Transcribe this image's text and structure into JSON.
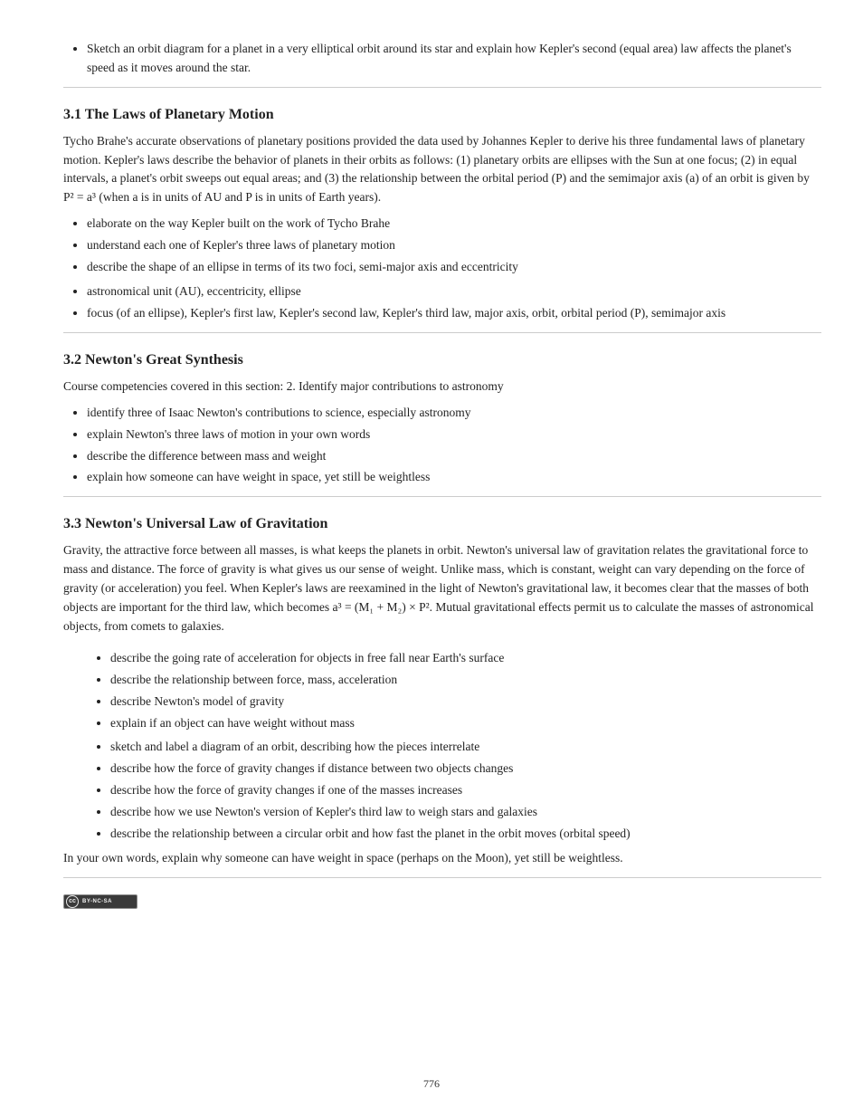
{
  "top_list": {
    "items": [
      "Sketch an orbit diagram for a planet in a very elliptical orbit around its star and explain how Kepler's second (equal area) law affects the planet's speed as it moves around the star."
    ]
  },
  "sec1": {
    "title": "3.1 The Laws of Planetary Motion",
    "intro": "Tycho Brahe's accurate observations of planetary positions provided the data used by Johannes Kepler to derive his three fundamental laws of planetary motion. Kepler's laws describe the behavior of planets in their orbits as follows: (1) planetary orbits are ellipses with the Sun at one focus; (2) in equal intervals, a planet's orbit sweeps out equal areas; and (3) the relationship between the orbital period (P) and the semimajor axis (a) of an orbit is given by P² = a³ (when a is in units of AU and P is in units of Earth years).",
    "list_a": [
      "elaborate on the way Kepler built on the work of Tycho Brahe",
      "understand each one of Kepler's three laws of planetary motion",
      "describe the shape of an ellipse in terms of its two foci, semi-major axis and eccentricity"
    ],
    "list_b": [
      "astronomical unit (AU), eccentricity, ellipse",
      "focus (of an ellipse), Kepler's first law, Kepler's second law, Kepler's third law, major axis, orbit, orbital period (P), semimajor axis"
    ]
  },
  "sec2": {
    "title": "3.2 Newton's Great Synthesis",
    "intro_a": "Course competencies covered in this section: 2. Identify major contributions to astronomy",
    "list_a": [
      "identify three of Isaac Newton's contributions to science, especially astronomy",
      "explain Newton's three laws of motion in your own words",
      "describe the difference between mass and weight",
      "explain how someone can have weight in space, yet still be weightless"
    ]
  },
  "sec3": {
    "title": "3.3 Newton's Universal Law of Gravitation",
    "intro": "Gravity, the attractive force between all masses, is what keeps the planets in orbit. Newton's universal law of gravitation relates the gravitational force to mass and distance. The force of gravity is what gives us our sense of weight. Unlike mass, which is constant, weight can vary depending on the force of gravity (or acceleration) you feel. When Kepler's laws are reexamined in the light of Newton's gravitational law, it becomes clear that the masses of both objects are important for the third law, which becomes a³ = (M₁ + M₂) × P². Mutual gravitational effects permit us to calculate the masses of astronomical objects, from comets to galaxies.",
    "list_a": [
      "describe the going rate of acceleration for objects in free fall near Earth's surface",
      "describe the relationship between force, mass, acceleration",
      "describe Newton's model of gravity",
      "explain if an object can have weight without mass"
    ],
    "list_b": [
      "sketch and label a diagram of an orbit, describing how the pieces interrelate",
      "describe how the force of gravity changes if distance between two objects changes",
      "describe how the force of gravity changes if one of the masses increases",
      "describe how we use Newton's version of Kepler's third law to weigh stars and galaxies",
      "describe the relationship between a circular orbit and how fast the planet in the orbit moves (orbital speed)"
    ],
    "outro": "In your own words, explain why someone can have weight in space (perhaps on the Moon), yet still be weightless."
  },
  "page_number": "776",
  "license_badge": {
    "text": "BY-NC-SA"
  }
}
